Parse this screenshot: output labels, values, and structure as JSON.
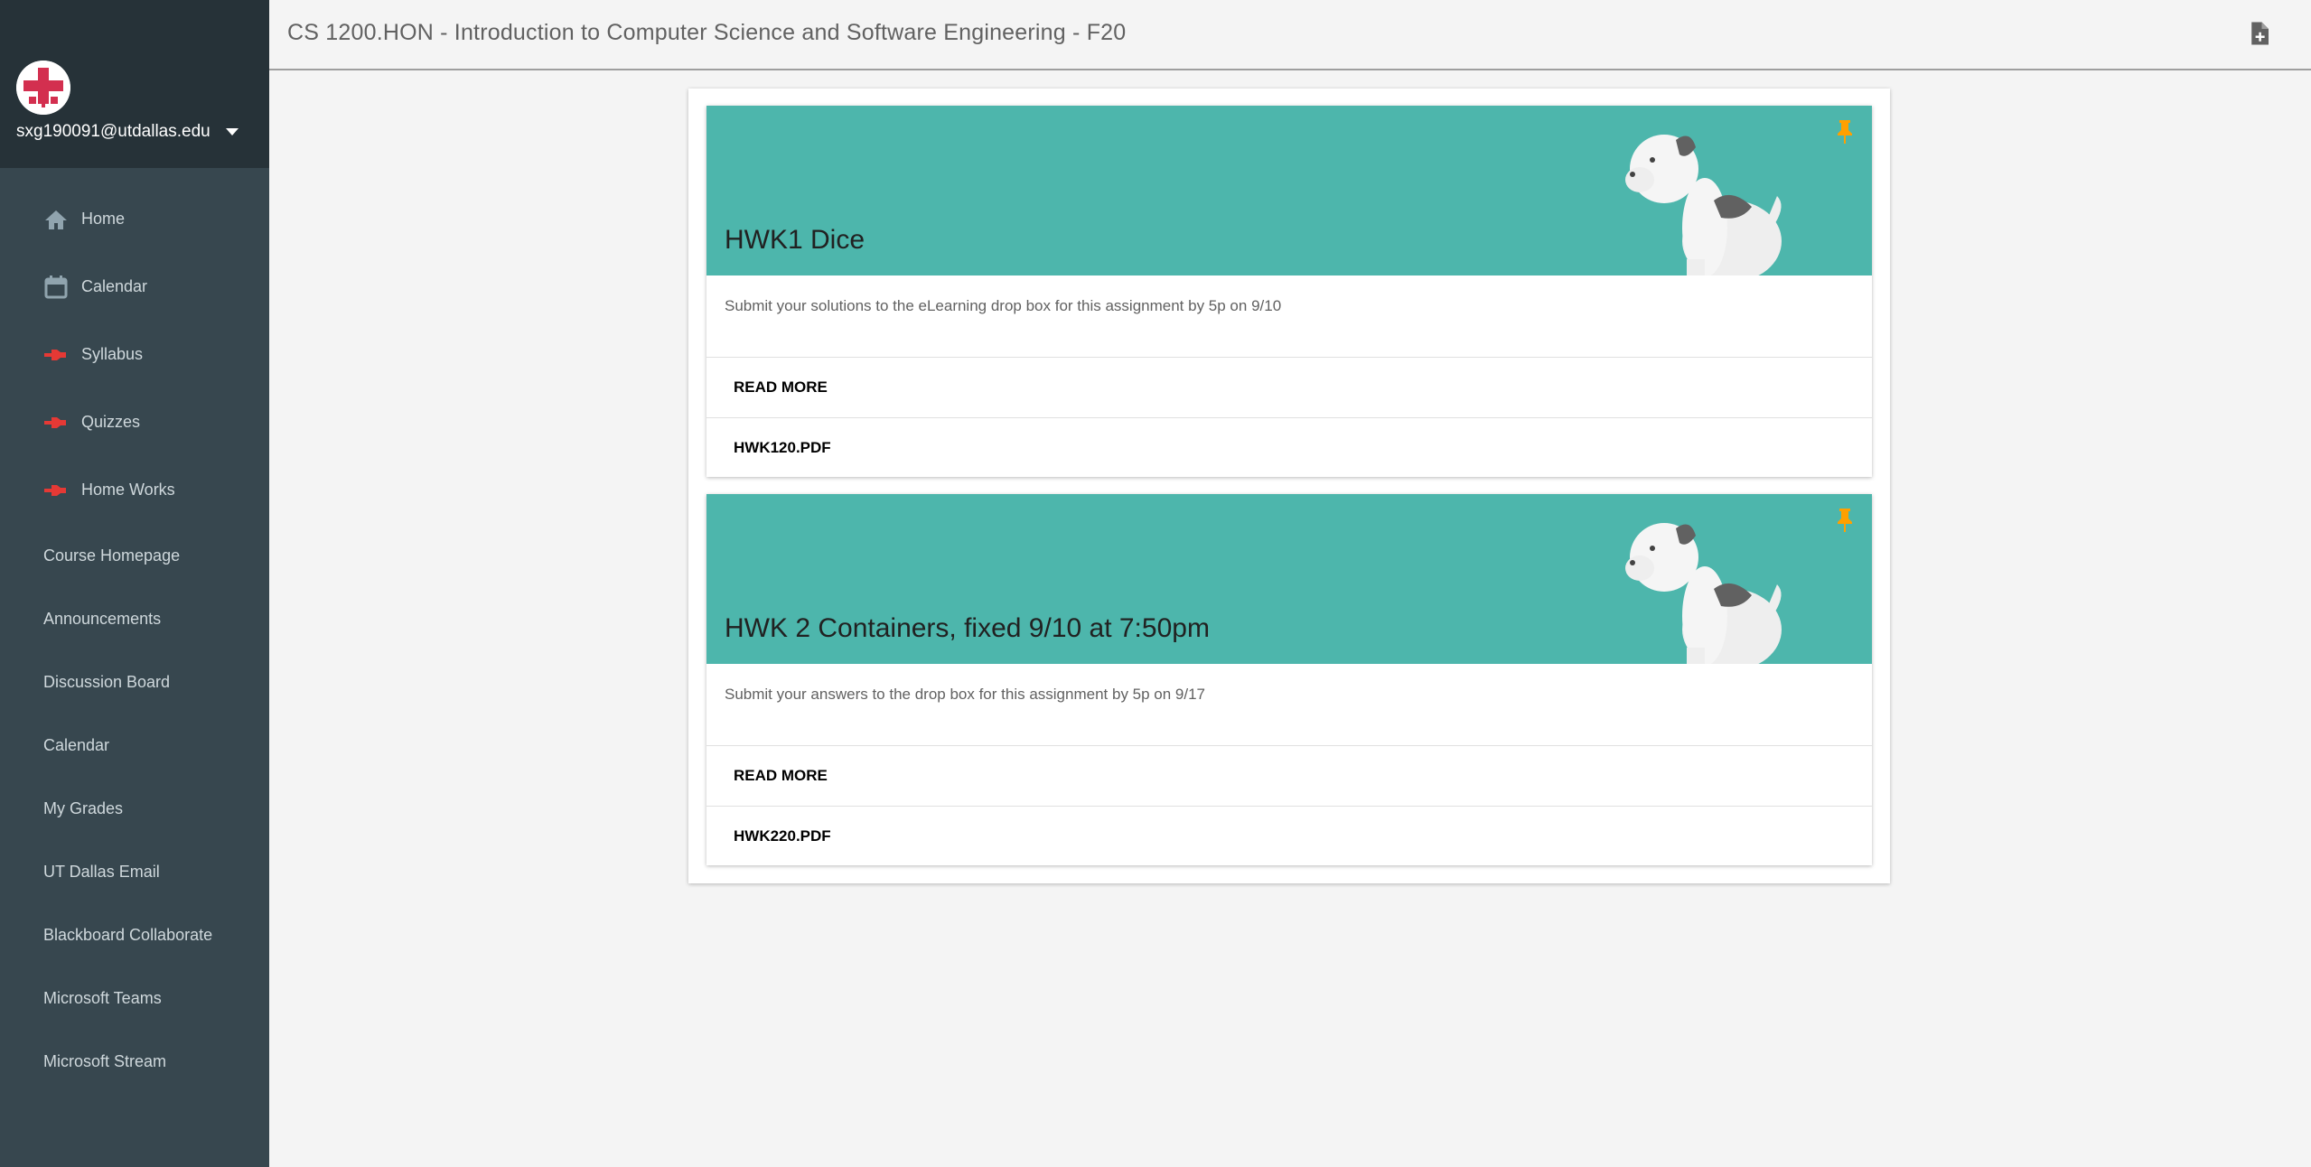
{
  "account": {
    "email": "sxg190091@utdallas.edu"
  },
  "sidebar": {
    "main_items": [
      {
        "label": "Home",
        "icon": "home-icon"
      },
      {
        "label": "Calendar",
        "icon": "calendar-icon"
      },
      {
        "label": "Syllabus",
        "icon": "red-pin-icon"
      },
      {
        "label": "Quizzes",
        "icon": "red-pin-icon"
      },
      {
        "label": "Home Works",
        "icon": "red-pin-icon"
      }
    ],
    "links": [
      "Course Homepage",
      "Announcements",
      "Discussion Board",
      "Calendar",
      "My Grades",
      "UT Dallas Email",
      "Blackboard Collaborate",
      "Microsoft Teams",
      "Microsoft Stream"
    ]
  },
  "header": {
    "course_title": "CS 1200.HON - Introduction to Computer Science and Software Engineering - F20"
  },
  "cards": [
    {
      "title": "HWK1 Dice",
      "description": "Submit your solutions to the eLearning drop box for this assignment by 5p on 9/10",
      "read_more": "READ MORE",
      "attachment": "HWK120.PDF"
    },
    {
      "title": "HWK 2 Containers, fixed 9/10 at 7:50pm",
      "description": "Submit your answers to the drop box for this assignment by 5p on 9/17",
      "read_more": "READ MORE",
      "attachment": "HWK220.PDF"
    }
  ],
  "colors": {
    "sidebar_bg": "#37474f",
    "sidebar_header_bg": "#263238",
    "banner_bg": "#4db6ac",
    "pin_color": "#ffa000",
    "nav_pin_color": "#e53935"
  }
}
